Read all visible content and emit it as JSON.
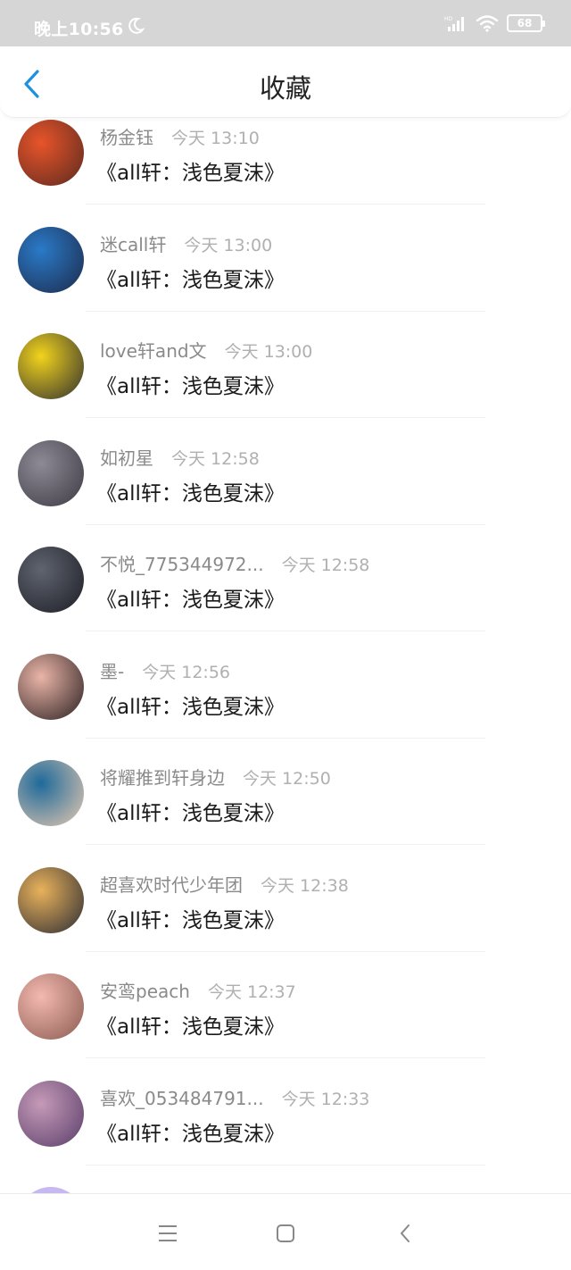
{
  "status_bar": {
    "time": "晚上10:56",
    "battery": "68"
  },
  "header": {
    "title": "收藏"
  },
  "items": [
    {
      "user": "杨金钰",
      "time": "今天 13:10",
      "title": "《all轩：浅色夏沫》",
      "avatar_colors": [
        "#e8542a",
        "#5b2a1f"
      ]
    },
    {
      "user": "迷call轩",
      "time": "今天 13:00",
      "title": "《all轩：浅色夏沫》",
      "avatar_colors": [
        "#2a7ac8",
        "#1d2a4a"
      ]
    },
    {
      "user": "love轩and文",
      "time": "今天 13:00",
      "title": "《all轩：浅色夏沫》",
      "avatar_colors": [
        "#f2d31c",
        "#2f2f2f"
      ]
    },
    {
      "user": "如初星",
      "time": "今天 12:58",
      "title": "《all轩：浅色夏沫》",
      "avatar_colors": [
        "#8d8a95",
        "#3d3a44"
      ]
    },
    {
      "user": "不悦_775344972...",
      "time": "今天 12:58",
      "title": "《all轩：浅色夏沫》",
      "avatar_colors": [
        "#5f6470",
        "#1c1e24"
      ]
    },
    {
      "user": "墨-",
      "time": "今天 12:56",
      "title": "《all轩：浅色夏沫》",
      "avatar_colors": [
        "#eab5a8",
        "#2a1f1f"
      ]
    },
    {
      "user": "将耀推到轩身边",
      "time": "今天 12:50",
      "title": "《all轩：浅色夏沫》",
      "avatar_colors": [
        "#1e6a9a",
        "#e8c9b0"
      ]
    },
    {
      "user": "超喜欢时代少年团",
      "time": "今天 12:38",
      "title": "《all轩：浅色夏沫》",
      "avatar_colors": [
        "#e9b25b",
        "#2b2b33"
      ]
    },
    {
      "user": "安鸾peach",
      "time": "今天 12:37",
      "title": "《all轩：浅色夏沫》",
      "avatar_colors": [
        "#f3b9b0",
        "#8a5a50"
      ]
    },
    {
      "user": "喜欢_053484791...",
      "time": "今天 12:33",
      "title": "《all轩：浅色夏沫》",
      "avatar_colors": [
        "#c59ab8",
        "#5a3e6a"
      ]
    },
    {
      "user": "",
      "time": "",
      "title": "",
      "avatar_colors": [
        "#c8b8f0",
        "#c8b8f0"
      ]
    }
  ],
  "colors": {
    "accent": "#1e90e0",
    "status_bar": "#d6d6d6"
  },
  "icons": {
    "back": "chevron-left-icon",
    "menu": "menu-icon",
    "home": "home-icon",
    "nav_back": "nav-back-icon"
  }
}
